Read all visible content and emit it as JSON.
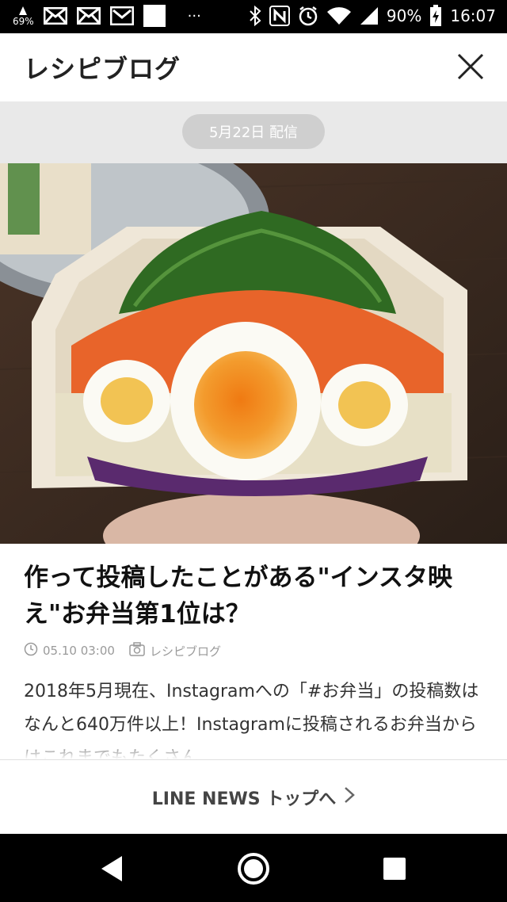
{
  "status_bar": {
    "left_badge_text": "69%",
    "battery_percent": "90%",
    "time": "16:07",
    "ellipsis": "···",
    "icons": [
      "notification-icon",
      "mail-icon",
      "mail-icon",
      "gmail-icon",
      "white-box-icon",
      "bluetooth-icon",
      "nfc-icon",
      "alarm-icon",
      "wifi-icon",
      "signal-icon",
      "battery-charging-icon"
    ]
  },
  "header": {
    "title": "レシピブログ",
    "close_icon": "close-icon"
  },
  "date_pill": {
    "text": "5月22日 配信"
  },
  "article": {
    "headline": "作って投稿したことがある\"インスタ映え\"お弁当第1位は？",
    "meta": {
      "time": "05.10 03:00",
      "source": "レシピブログ"
    },
    "body": "2018年5月現在、Instagramへの「#お弁当」の投稿数はなんと640万件以上！Instagramに投稿されるお弁当からはこれまでもたくさん"
  },
  "footer": {
    "link_label": "LINE NEWS トップへ",
    "chevron_icon": "chevron-right-icon"
  },
  "navigation": {
    "buttons": [
      "back-icon",
      "home-icon",
      "recents-icon"
    ]
  },
  "colors": {
    "status_bar_bg": "#000000",
    "date_band_bg": "#e9e9e9",
    "date_pill_bg": "#cfcfcf",
    "headline": "#111111",
    "meta": "#9a9a9a"
  }
}
